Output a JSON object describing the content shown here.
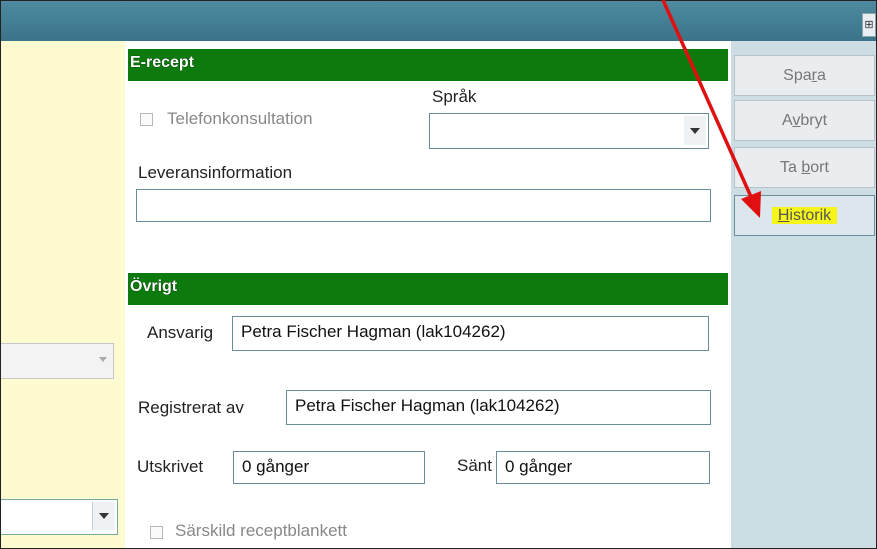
{
  "window": {
    "corner_glyph": "⊞"
  },
  "erecept": {
    "header": "E-recept",
    "telefonkonsultation_label": "Telefonkonsultation",
    "sprak_label": "Språk",
    "sprak_value": "",
    "leveransinformation_label": "Leveransinformation",
    "leveransinformation_value": ""
  },
  "ovrigt": {
    "header": "Övrigt",
    "ansvarig_label": "Ansvarig",
    "ansvarig_value": "Petra Fischer Hagman (lak104262)",
    "registrerat_label": "Registrerat av",
    "registrerat_value": "Petra Fischer Hagman (lak104262)",
    "utskrivet_label": "Utskrivet",
    "utskrivet_value": "0 gånger",
    "sant_label": "Sänt",
    "sant_value": "0 gånger",
    "sarskild_label": "Särskild receptblankett"
  },
  "buttons": {
    "spara": {
      "pre": "Spa",
      "underline": "r",
      "post": "a"
    },
    "avbryt": {
      "pre": "A",
      "underline": "v",
      "post": "bryt"
    },
    "ta_bort": {
      "pre": "Ta ",
      "underline": "b",
      "post": "ort"
    },
    "historik": {
      "pre": "",
      "underline": "H",
      "post": "istorik"
    }
  },
  "colors": {
    "section_header": "#0c7a0c",
    "left_panel": "#fffbd0",
    "right_panel": "#ccdde3",
    "highlight": "#f5f51a",
    "annotation_arrow": "#e01010"
  }
}
